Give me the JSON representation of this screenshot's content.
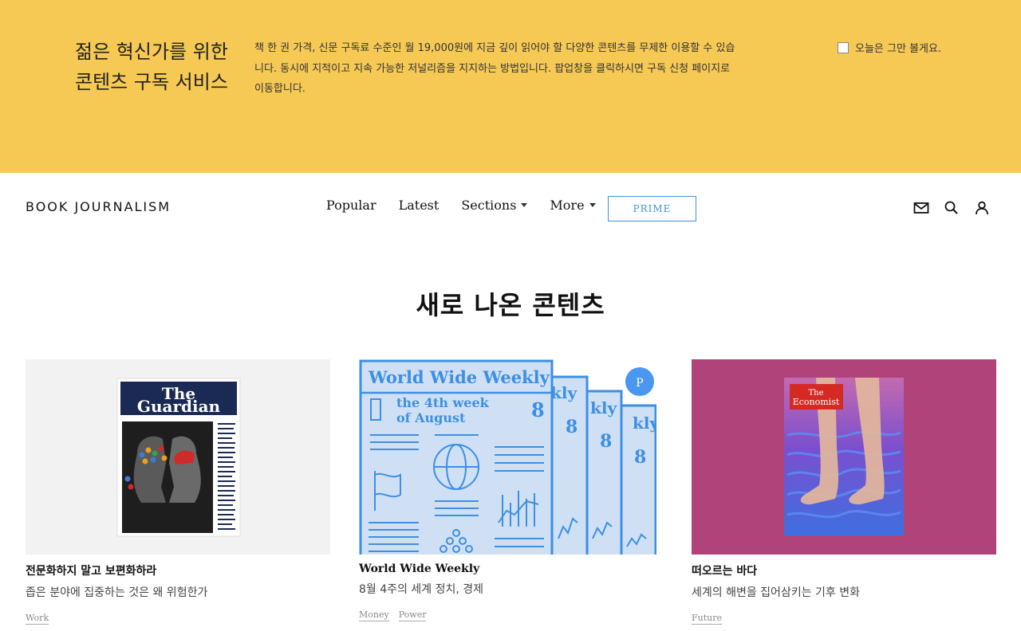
{
  "promo": {
    "title": "젊은 혁신가를 위한 콘텐츠 구독 서비스",
    "text": "책 한 권 가격, 신문 구독료 수준인 월 19,000원에 지금 깊이 읽어야 할 다양한 콘텐츠를 무제한 이용할 수 있습니다. 동시에 지적이고 지속 가능한 저널리즘을 지지하는 방법입니다. 팝업창을 클릭하시면 구독 신청 페이지로 이동합니다.",
    "dismiss_label": "오늘은 그만 볼게요."
  },
  "header": {
    "logo": "BOOK JOURNALISM",
    "nav": {
      "popular": "Popular",
      "latest": "Latest",
      "sections": "Sections",
      "more": "More"
    },
    "prime_label": "PRIME",
    "icons": [
      "mail-icon",
      "search-icon",
      "user-icon"
    ]
  },
  "main": {
    "section_title": "새로 나온 콘텐츠",
    "cards": [
      {
        "title": "전문화하지 말고 보편화하라",
        "subtitle": "좁은 분야에 집중하는 것은 왜 위험한가",
        "tags": [
          "Work"
        ],
        "cover_masthead": [
          "The",
          "Guardian"
        ]
      },
      {
        "title": "World Wide Weekly",
        "subtitle": "8월 4주의 세계 정치, 경제",
        "tags": [
          "Money",
          "Power"
        ],
        "cover_title": "World Wide Weekly",
        "cover_week": [
          "the 4th week",
          "of August"
        ],
        "cover_number": "8",
        "cover_stack_labels": [
          "kly",
          "kly",
          "kly"
        ],
        "badge": "P"
      },
      {
        "title": "떠오르는 바다",
        "subtitle": "세계의 해변을 집어삼키는 기후 변화",
        "tags": [
          "Future"
        ],
        "cover_masthead": [
          "The",
          "Economist"
        ]
      }
    ]
  },
  "colors": {
    "banner": "#f6c955",
    "accent": "#3d8fe3",
    "economist_bg": "#b0447a"
  }
}
